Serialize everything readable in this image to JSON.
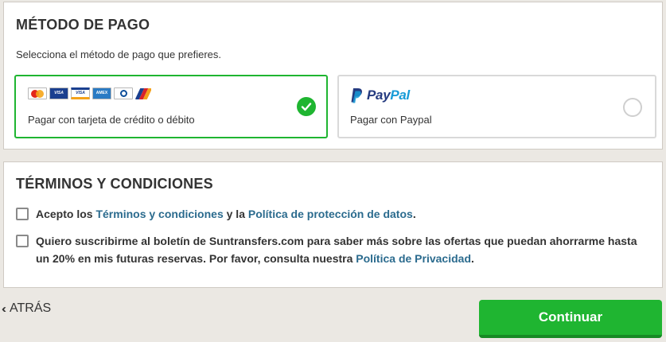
{
  "payment": {
    "title": "MÉTODO DE PAGO",
    "subtitle": "Selecciona el método de pago que prefieres.",
    "options": [
      {
        "id": "card",
        "label": "Pagar con tarjeta de crédito o débito",
        "selected": true,
        "logos": [
          "mastercard-icon",
          "visa-electron-icon",
          "visa-icon",
          "amex-icon",
          "diners-club-icon",
          "jcb-icon"
        ],
        "logo_text": {
          "visa_electron": "VISA",
          "visa": "VISA",
          "amex": "AMEX",
          "diners": "Diners Club"
        }
      },
      {
        "id": "paypal",
        "label": "Pagar con Paypal",
        "selected": false,
        "brand_pay": "Pay",
        "brand_pal": "Pal"
      }
    ]
  },
  "terms": {
    "title": "TÉRMINOS Y CONDICIONES",
    "items": [
      {
        "checked": false,
        "text_before": "Acepto los ",
        "link1": "Términos y condiciones",
        "text_middle": " y la ",
        "link2": "Política de protección de datos",
        "text_after": "."
      },
      {
        "checked": false,
        "text_before": "Quiero suscribirme al boletín de Suntransfers.com para saber más sobre las ofertas que puedan ahorrarme hasta un 20% en mis futuras reservas. Por favor, consulta nuestra ",
        "link": "Política de Privacidad",
        "text_after": "."
      }
    ]
  },
  "footer": {
    "back_label": "ATRÁS",
    "continue_label": "Continuar"
  },
  "colors": {
    "accent_green": "#1fb531",
    "link_blue": "#2b6b8e",
    "paypal_dark": "#253b80",
    "paypal_light": "#179bd7"
  }
}
